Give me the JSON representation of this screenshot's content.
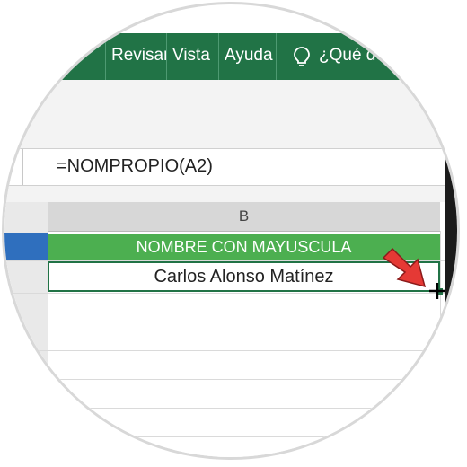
{
  "ribbon": {
    "tabs": [
      "Revisar",
      "Vista",
      "Ayuda"
    ],
    "tell_me": "¿Qué desea hacer?"
  },
  "formula_bar": {
    "formula": "=NOMPROPIO(A2)"
  },
  "sheet": {
    "column_header": "B",
    "header_cell": "NOMBRE CON MAYUSCULA",
    "result_cell": "Carlos Alonso Matínez"
  },
  "colors": {
    "ribbon": "#217346",
    "header_fill": "#4caf50",
    "arrow": "#e53935"
  }
}
